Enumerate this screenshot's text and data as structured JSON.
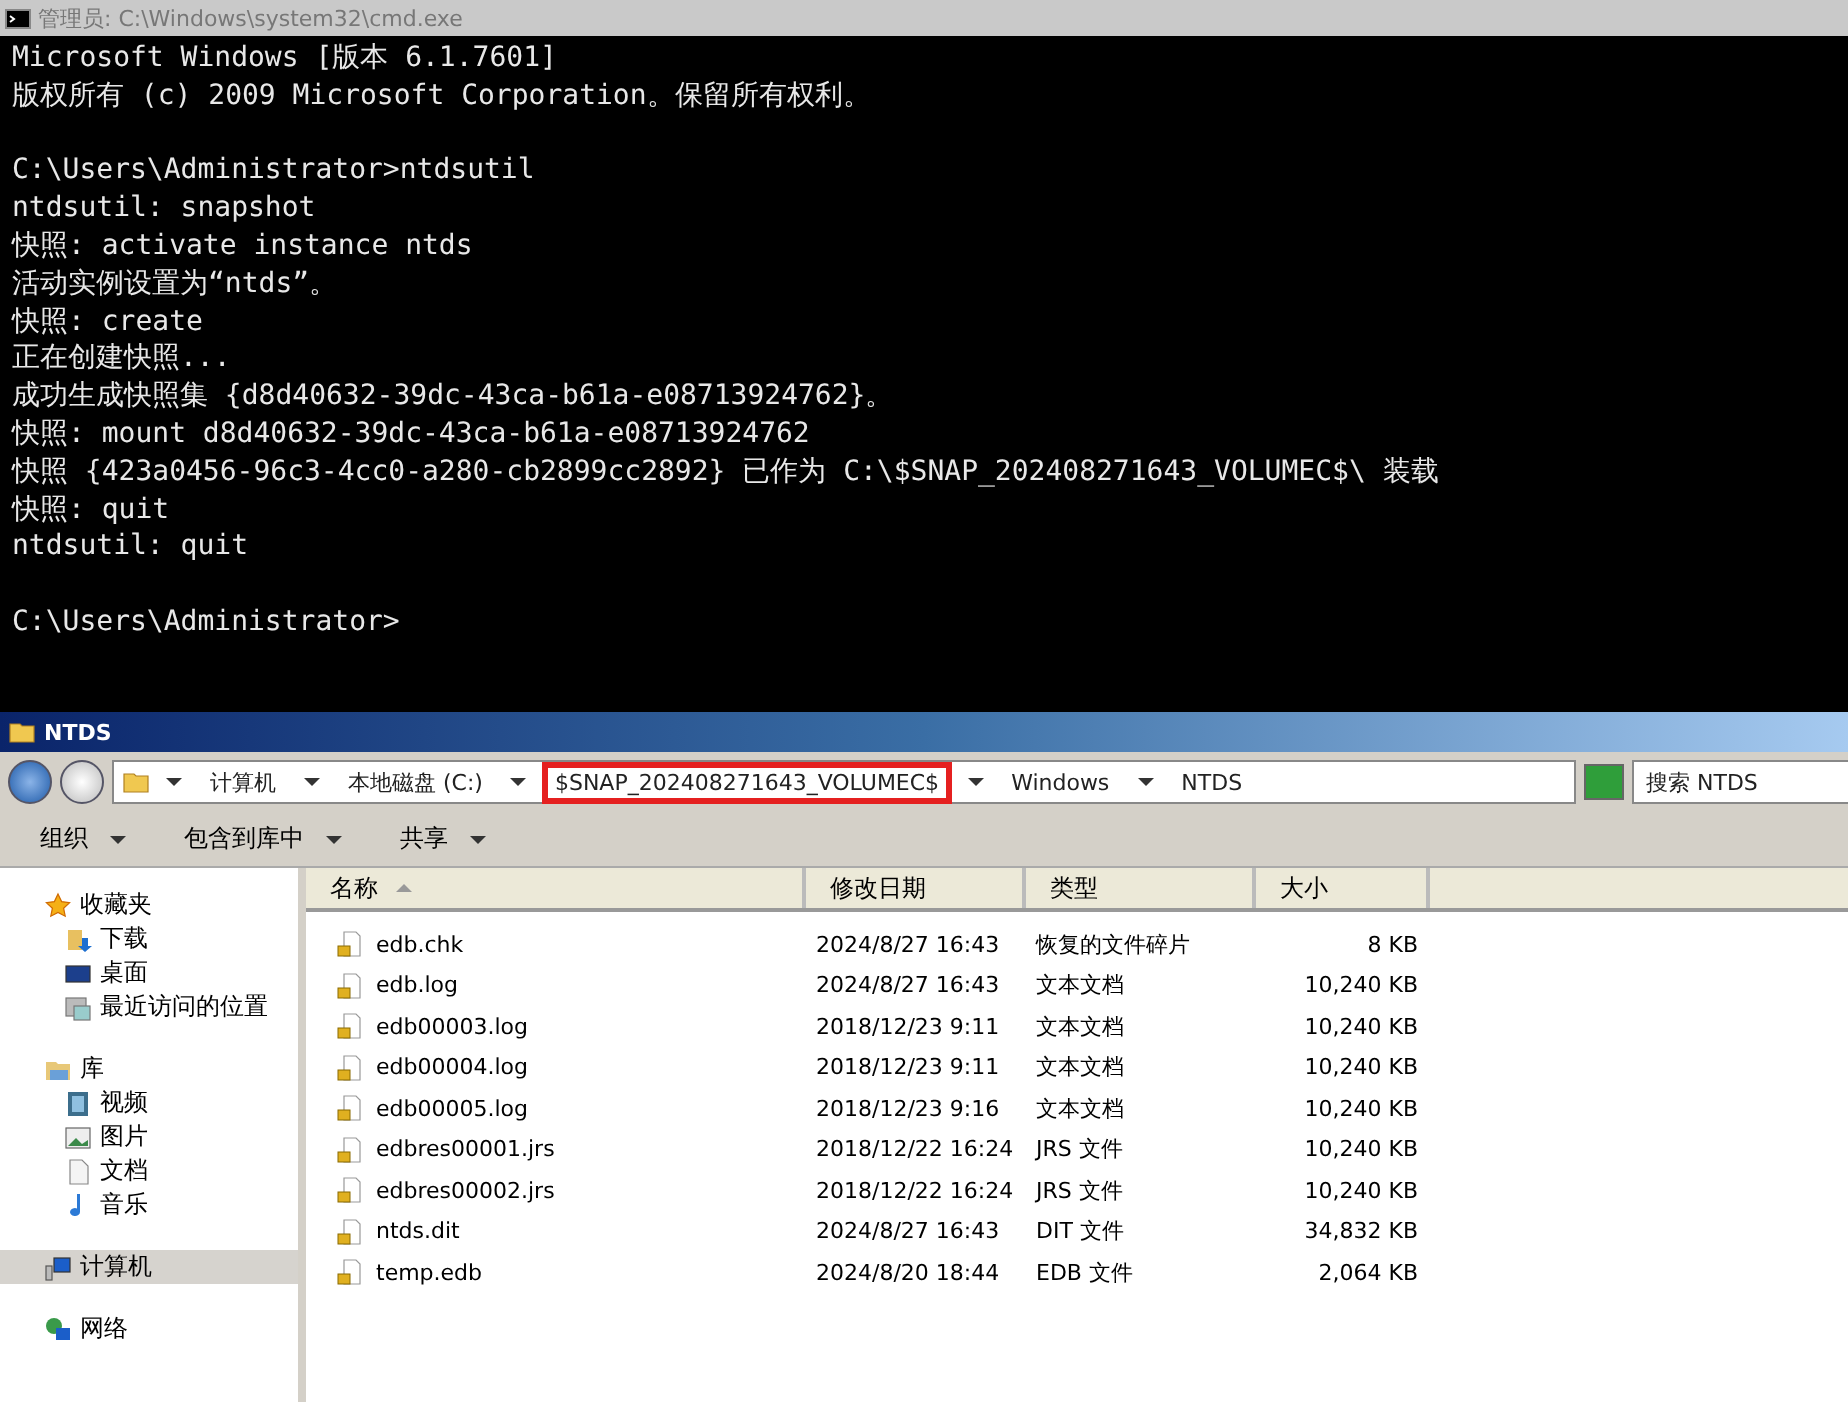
{
  "console": {
    "title": "管理员: C:\\Windows\\system32\\cmd.exe",
    "blocks": [
      [
        "Microsoft Windows [版本 6.1.7601]",
        "版权所有 (c) 2009 Microsoft Corporation。保留所有权利。"
      ],
      [
        "C:\\Users\\Administrator>ntdsutil",
        "ntdsutil: snapshot",
        "快照: activate instance ntds",
        "活动实例设置为“ntds”。",
        "快照: create",
        "正在创建快照...",
        "成功生成快照集 {d8d40632-39dc-43ca-b61a-e08713924762}。",
        "快照: mount d8d40632-39dc-43ca-b61a-e08713924762",
        "快照 {423a0456-96c3-4cc0-a280-cb2899cc2892} 已作为 C:\\$SNAP_202408271643_VOLUMEC$\\ 装载",
        "快照: quit",
        "ntdsutil: quit"
      ],
      [
        "C:\\Users\\Administrator>"
      ]
    ]
  },
  "explorer": {
    "title": "NTDS",
    "breadcrumb": [
      {
        "label": "计算机",
        "highlighted": false
      },
      {
        "label": "本地磁盘 (C:)",
        "highlighted": false
      },
      {
        "label": "$SNAP_202408271643_VOLUMEC$",
        "highlighted": true
      },
      {
        "label": "Windows",
        "highlighted": false
      },
      {
        "label": "NTDS",
        "highlighted": false
      }
    ],
    "search": {
      "placeholder": "搜索 NTDS"
    },
    "toolbar": [
      "组织",
      "包含到库中",
      "共享"
    ],
    "nav": [
      {
        "label": "收藏夹",
        "selected": false,
        "children": [
          {
            "label": "下载",
            "selected": false
          },
          {
            "label": "桌面",
            "selected": false
          },
          {
            "label": "最近访问的位置",
            "selected": false
          }
        ]
      },
      {
        "label": "库",
        "selected": false,
        "children": [
          {
            "label": "视频",
            "selected": false
          },
          {
            "label": "图片",
            "selected": false
          },
          {
            "label": "文档",
            "selected": false
          },
          {
            "label": "音乐",
            "selected": false
          }
        ]
      },
      {
        "label": "计算机",
        "selected": true
      },
      {
        "label": "网络",
        "selected": false
      }
    ],
    "columns": [
      "名称",
      "修改日期",
      "类型",
      "大小"
    ],
    "rows": [
      {
        "name": "edb.chk",
        "date": "2024/8/27 16:43",
        "type": "恢复的文件碎片",
        "size": "8 KB"
      },
      {
        "name": "edb.log",
        "date": "2024/8/27 16:43",
        "type": "文本文档",
        "size": "10,240 KB"
      },
      {
        "name": "edb00003.log",
        "date": "2018/12/23 9:11",
        "type": "文本文档",
        "size": "10,240 KB"
      },
      {
        "name": "edb00004.log",
        "date": "2018/12/23 9:11",
        "type": "文本文档",
        "size": "10,240 KB"
      },
      {
        "name": "edb00005.log",
        "date": "2018/12/23 9:16",
        "type": "文本文档",
        "size": "10,240 KB"
      },
      {
        "name": "edbres00001.jrs",
        "date": "2018/12/22 16:24",
        "type": "JRS 文件",
        "size": "10,240 KB"
      },
      {
        "name": "edbres00002.jrs",
        "date": "2018/12/22 16:24",
        "type": "JRS 文件",
        "size": "10,240 KB"
      },
      {
        "name": "ntds.dit",
        "date": "2024/8/27 16:43",
        "type": "DIT 文件",
        "size": "34,832 KB"
      },
      {
        "name": "temp.edb",
        "date": "2024/8/20 18:44",
        "type": "EDB 文件",
        "size": "2,064 KB"
      }
    ]
  }
}
